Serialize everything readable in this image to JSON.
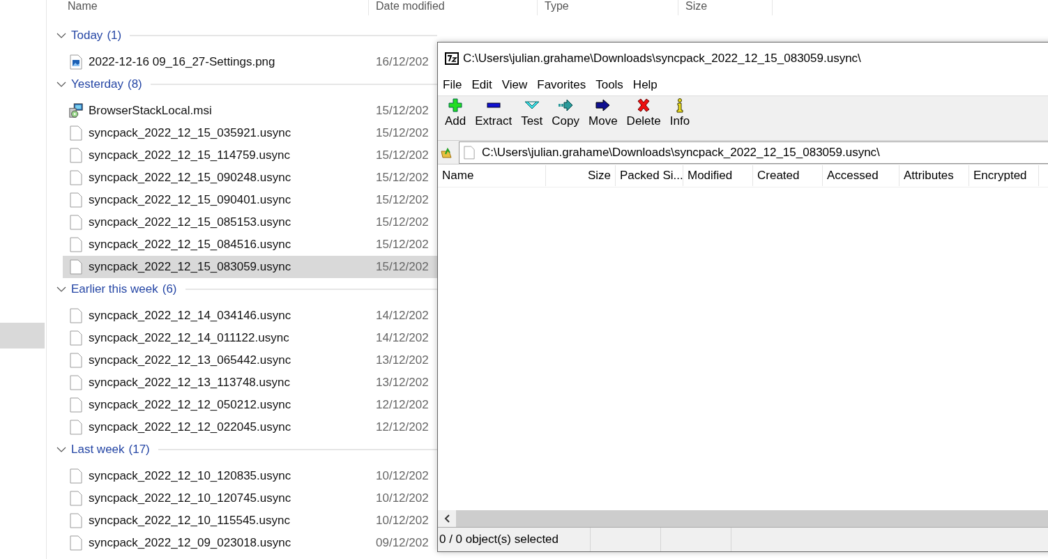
{
  "explorer": {
    "columns": [
      "Name",
      "Date modified",
      "Type",
      "Size"
    ],
    "groups": [
      {
        "label": "Today",
        "count": "(1)",
        "expanded": true,
        "files": [
          {
            "name": "2022-12-16 09_16_27-Settings.png",
            "kind": "image",
            "date": "16/12/202",
            "selected": false
          }
        ]
      },
      {
        "label": "Yesterday",
        "count": "(8)",
        "expanded": true,
        "files": [
          {
            "name": "BrowserStackLocal.msi",
            "kind": "installer",
            "date": "15/12/202",
            "selected": false
          },
          {
            "name": "syncpack_2022_12_15_035921.usync",
            "kind": "file",
            "date": "15/12/202",
            "selected": false
          },
          {
            "name": "syncpack_2022_12_15_114759.usync",
            "kind": "file",
            "date": "15/12/202",
            "selected": false
          },
          {
            "name": "syncpack_2022_12_15_090248.usync",
            "kind": "file",
            "date": "15/12/202",
            "selected": false
          },
          {
            "name": "syncpack_2022_12_15_090401.usync",
            "kind": "file",
            "date": "15/12/202",
            "selected": false
          },
          {
            "name": "syncpack_2022_12_15_085153.usync",
            "kind": "file",
            "date": "15/12/202",
            "selected": false
          },
          {
            "name": "syncpack_2022_12_15_084516.usync",
            "kind": "file",
            "date": "15/12/202",
            "selected": false
          },
          {
            "name": "syncpack_2022_12_15_083059.usync",
            "kind": "file",
            "date": "15/12/202",
            "selected": true
          }
        ]
      },
      {
        "label": "Earlier this week",
        "count": "(6)",
        "expanded": true,
        "files": [
          {
            "name": "syncpack_2022_12_14_034146.usync",
            "kind": "file",
            "date": "14/12/202",
            "selected": false
          },
          {
            "name": "syncpack_2022_12_14_011122.usync",
            "kind": "file",
            "date": "14/12/202",
            "selected": false
          },
          {
            "name": "syncpack_2022_12_13_065442.usync",
            "kind": "file",
            "date": "13/12/202",
            "selected": false
          },
          {
            "name": "syncpack_2022_12_13_113748.usync",
            "kind": "file",
            "date": "13/12/202",
            "selected": false
          },
          {
            "name": "syncpack_2022_12_12_050212.usync",
            "kind": "file",
            "date": "12/12/202",
            "selected": false
          },
          {
            "name": "syncpack_2022_12_12_022045.usync",
            "kind": "file",
            "date": "12/12/202",
            "selected": false
          }
        ]
      },
      {
        "label": "Last week",
        "count": "(17)",
        "expanded": true,
        "files": [
          {
            "name": "syncpack_2022_12_10_120835.usync",
            "kind": "file",
            "date": "10/12/202",
            "selected": false
          },
          {
            "name": "syncpack_2022_12_10_120745.usync",
            "kind": "file",
            "date": "10/12/202",
            "selected": false
          },
          {
            "name": "syncpack_2022_12_10_115545.usync",
            "kind": "file",
            "date": "10/12/202",
            "selected": false
          },
          {
            "name": "syncpack_2022_12_09_023018.usync",
            "kind": "file",
            "date": "09/12/202",
            "selected": false
          }
        ]
      }
    ]
  },
  "archiver": {
    "title": "C:\\Users\\julian.grahame\\Downloads\\syncpack_2022_12_15_083059.usync\\",
    "menu": [
      "File",
      "Edit",
      "View",
      "Favorites",
      "Tools",
      "Help"
    ],
    "toolbar": [
      {
        "label": "Add",
        "kind": "add"
      },
      {
        "label": "Extract",
        "kind": "extract"
      },
      {
        "label": "Test",
        "kind": "test"
      },
      {
        "label": "Copy",
        "kind": "copy"
      },
      {
        "label": "Move",
        "kind": "move"
      },
      {
        "label": "Delete",
        "kind": "delete"
      },
      {
        "label": "Info",
        "kind": "info"
      }
    ],
    "address": "C:\\Users\\julian.grahame\\Downloads\\syncpack_2022_12_15_083059.usync\\",
    "columns": [
      "Name",
      "Size",
      "Packed Si...",
      "Modified",
      "Created",
      "Accessed",
      "Attributes",
      "Encrypted"
    ],
    "status": "0 / 0 object(s) selected"
  }
}
